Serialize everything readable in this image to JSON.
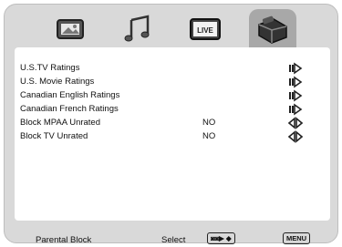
{
  "tabs": [
    {
      "icon": "picture-icon",
      "selected": false
    },
    {
      "icon": "music-notes-icon",
      "selected": false
    },
    {
      "icon": "live-icon",
      "label": "LIVE",
      "selected": false
    },
    {
      "icon": "parental-toolbox-icon",
      "selected": true
    }
  ],
  "menu": {
    "rows": [
      {
        "label": "U.S.TV Ratings",
        "value": "",
        "control": "enter-arrow-icon"
      },
      {
        "label": "U.S. Movie Ratings",
        "value": "",
        "control": "enter-arrow-icon"
      },
      {
        "label": "Canadian English Ratings",
        "value": "",
        "control": "enter-arrow-icon"
      },
      {
        "label": "Canadian French Ratings",
        "value": "",
        "control": "enter-arrow-icon"
      },
      {
        "label": "Block MPAA Unrated",
        "value": "NO",
        "control": "left-right-arrows-icon"
      },
      {
        "label": "Block TV Unrated",
        "value": "NO",
        "control": "left-right-arrows-icon"
      }
    ]
  },
  "footer": {
    "title": "Parental Block",
    "action": "Select",
    "nav_key": "◙◙▶ ◆",
    "menu_key": "MENU"
  }
}
